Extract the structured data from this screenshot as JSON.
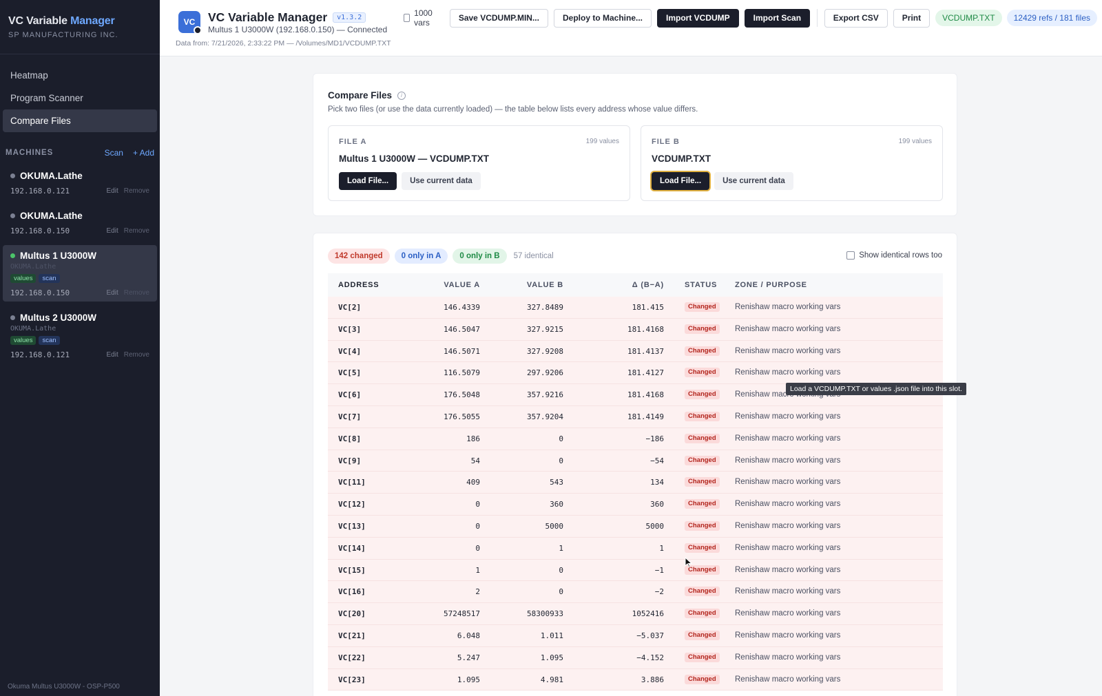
{
  "brand": {
    "title_main": "VC Variable",
    "title_accent": "Manager",
    "subtitle": "SP MANUFACTURING INC."
  },
  "nav": [
    {
      "label": "Heatmap"
    },
    {
      "label": "Program Scanner"
    },
    {
      "label": "Compare Files"
    }
  ],
  "machines_section": {
    "label": "MACHINES",
    "scan": "Scan",
    "add": "+ Add"
  },
  "machines": [
    {
      "name": "OKUMA.Lathe",
      "ip": "192.168.0.121",
      "edit": "Edit",
      "remove": "Remove"
    },
    {
      "name": "OKUMA.Lathe",
      "ip": "192.168.0.150",
      "edit": "Edit",
      "remove": "Remove"
    },
    {
      "name": "Multus 1 U3000W",
      "type": "OKUMA.Lathe",
      "tag_values": "values",
      "tag_scan": "scan",
      "ip": "192.168.0.150",
      "edit": "Edit",
      "remove": "Remove"
    },
    {
      "name": "Multus 2 U3000W",
      "type": "OKUMA.Lathe",
      "tag_values": "values",
      "tag_scan": "scan",
      "ip": "192.168.0.121",
      "edit": "Edit",
      "remove": "Remove"
    }
  ],
  "sidebar_footer": "Okuma Multus U3000W - OSP-P500",
  "header": {
    "logo_text": "VC",
    "title": "VC Variable Manager",
    "version": "v1.3.2",
    "connection": "Multus 1 U3000W (192.168.0.150) — Connected",
    "data_from": "Data from: 7/21/2026, 2:33:22 PM — /Volumes/MD1/VCDUMP.TXT"
  },
  "toolbar": {
    "vars_1000": "1000 vars",
    "save": "Save VCDUMP.MIN...",
    "deploy": "Deploy to Machine...",
    "import_vcdump": "Import VCDUMP",
    "import_scan": "Import Scan",
    "export_csv": "Export CSV",
    "print": "Print",
    "file_pill": "VCDUMP.TXT",
    "refs_pill": "12429 refs / 181 files"
  },
  "compare": {
    "title": "Compare Files",
    "description": "Pick two files (or use the data currently loaded) — the table below lists every address whose value differs.",
    "file_a": {
      "label": "FILE A",
      "count": "199 values",
      "name": "Multus 1 U3000W — VCDUMP.TXT",
      "load": "Load File...",
      "use_current": "Use current data"
    },
    "file_b": {
      "label": "FILE B",
      "count": "199 values",
      "name": "VCDUMP.TXT",
      "load": "Load File...",
      "use_current": "Use current data"
    }
  },
  "summary": {
    "changed": "142 changed",
    "only_a": "0 only in A",
    "only_b": "0 only in B",
    "identical": "57 identical",
    "show_identical": "Show identical rows too"
  },
  "table": {
    "headers": {
      "address": "ADDRESS",
      "value_a": "VALUE A",
      "value_b": "VALUE B",
      "delta": "Δ (B−A)",
      "status": "STATUS",
      "zone": "ZONE / PURPOSE"
    },
    "rows": [
      {
        "address": "VC[2]",
        "a": "146.4339",
        "b": "327.8489",
        "delta": "181.415",
        "status": "Changed",
        "zone": "Renishaw macro working vars"
      },
      {
        "address": "VC[3]",
        "a": "146.5047",
        "b": "327.9215",
        "delta": "181.4168",
        "status": "Changed",
        "zone": "Renishaw macro working vars"
      },
      {
        "address": "VC[4]",
        "a": "146.5071",
        "b": "327.9208",
        "delta": "181.4137",
        "status": "Changed",
        "zone": "Renishaw macro working vars"
      },
      {
        "address": "VC[5]",
        "a": "116.5079",
        "b": "297.9206",
        "delta": "181.4127",
        "status": "Changed",
        "zone": "Renishaw macro working vars"
      },
      {
        "address": "VC[6]",
        "a": "176.5048",
        "b": "357.9216",
        "delta": "181.4168",
        "status": "Changed",
        "zone": "Renishaw macro working vars"
      },
      {
        "address": "VC[7]",
        "a": "176.5055",
        "b": "357.9204",
        "delta": "181.4149",
        "status": "Changed",
        "zone": "Renishaw macro working vars"
      },
      {
        "address": "VC[8]",
        "a": "186",
        "b": "0",
        "delta": "−186",
        "status": "Changed",
        "zone": "Renishaw macro working vars"
      },
      {
        "address": "VC[9]",
        "a": "54",
        "b": "0",
        "delta": "−54",
        "status": "Changed",
        "zone": "Renishaw macro working vars"
      },
      {
        "address": "VC[11]",
        "a": "409",
        "b": "543",
        "delta": "134",
        "status": "Changed",
        "zone": "Renishaw macro working vars"
      },
      {
        "address": "VC[12]",
        "a": "0",
        "b": "360",
        "delta": "360",
        "status": "Changed",
        "zone": "Renishaw macro working vars"
      },
      {
        "address": "VC[13]",
        "a": "0",
        "b": "5000",
        "delta": "5000",
        "status": "Changed",
        "zone": "Renishaw macro working vars"
      },
      {
        "address": "VC[14]",
        "a": "0",
        "b": "1",
        "delta": "1",
        "status": "Changed",
        "zone": "Renishaw macro working vars"
      },
      {
        "address": "VC[15]",
        "a": "1",
        "b": "0",
        "delta": "−1",
        "status": "Changed",
        "zone": "Renishaw macro working vars"
      },
      {
        "address": "VC[16]",
        "a": "2",
        "b": "0",
        "delta": "−2",
        "status": "Changed",
        "zone": "Renishaw macro working vars"
      },
      {
        "address": "VC[20]",
        "a": "57248517",
        "b": "58300933",
        "delta": "1052416",
        "status": "Changed",
        "zone": "Renishaw macro working vars"
      },
      {
        "address": "VC[21]",
        "a": "6.048",
        "b": "1.011",
        "delta": "−5.037",
        "status": "Changed",
        "zone": "Renishaw macro working vars"
      },
      {
        "address": "VC[22]",
        "a": "5.247",
        "b": "1.095",
        "delta": "−4.152",
        "status": "Changed",
        "zone": "Renishaw macro working vars"
      },
      {
        "address": "VC[23]",
        "a": "1.095",
        "b": "4.981",
        "delta": "3.886",
        "status": "Changed",
        "zone": "Renishaw macro working vars"
      }
    ]
  },
  "tooltip": "Load a VCDUMP.TXT or values .json file into this slot."
}
